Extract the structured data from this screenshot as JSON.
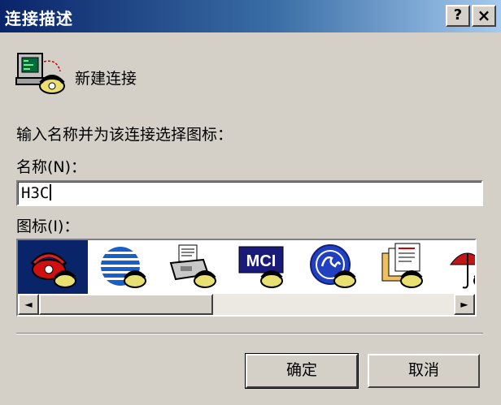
{
  "window": {
    "title": "连接描述",
    "help_button": "?",
    "close_button": "×"
  },
  "connection": {
    "icon": "telephone-computer-icon",
    "title": "新建连接"
  },
  "form": {
    "prompt": "输入名称并为该连接选择图标：",
    "name_label": "名称(N)：",
    "name_value": "H3C",
    "icon_label": "图标(I)："
  },
  "icon_list": {
    "items": [
      {
        "icon": "red-telephone-icon",
        "selected": true
      },
      {
        "icon": "striped-globe-icon",
        "selected": false
      },
      {
        "icon": "fax-machine-icon",
        "selected": false
      },
      {
        "icon": "mci-logo-icon",
        "text": "MCI",
        "selected": false
      },
      {
        "icon": "ge-logo-icon",
        "selected": false
      },
      {
        "icon": "documents-icon",
        "selected": false
      },
      {
        "icon": "umbrella-icon",
        "selected": false
      }
    ],
    "scroll_left": "◄",
    "scroll_right": "►"
  },
  "buttons": {
    "ok": "确定",
    "cancel": "取消"
  }
}
